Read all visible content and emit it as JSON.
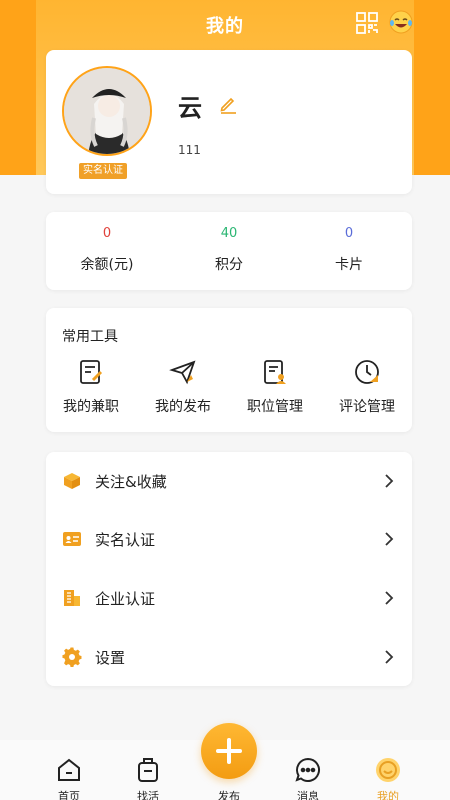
{
  "header": {
    "title": "我的"
  },
  "profile": {
    "nickname": "云",
    "user_id": "111",
    "verify_badge": "实名认证"
  },
  "stats": [
    {
      "value": "0",
      "label": "余额(元)",
      "color": "#e0413a"
    },
    {
      "value": "40",
      "label": "积分",
      "color": "#2bb673"
    },
    {
      "value": "0",
      "label": "卡片",
      "color": "#5a6cd8"
    }
  ],
  "tools": {
    "title": "常用工具",
    "items": [
      {
        "label": "我的兼职",
        "icon": "part-time-job-icon"
      },
      {
        "label": "我的发布",
        "icon": "paper-plane-icon"
      },
      {
        "label": "职位管理",
        "icon": "position-manage-icon"
      },
      {
        "label": "评论管理",
        "icon": "clock-icon"
      }
    ]
  },
  "menu": [
    {
      "label": "关注&收藏",
      "icon": "box-icon"
    },
    {
      "label": "实名认证",
      "icon": "id-card-icon"
    },
    {
      "label": "企业认证",
      "icon": "building-icon"
    },
    {
      "label": "设置",
      "icon": "gear-icon"
    }
  ],
  "tabbar": {
    "items": [
      {
        "label": "首页",
        "icon": "home-icon"
      },
      {
        "label": "找活",
        "icon": "briefcase-icon"
      },
      {
        "label": "发布",
        "icon": "plus-icon"
      },
      {
        "label": "消息",
        "icon": "chat-icon"
      },
      {
        "label": "我的",
        "icon": "profile-icon"
      }
    ],
    "active": "我的"
  },
  "colors": {
    "accent": "#ffa318",
    "accent_dark": "#e8a024"
  }
}
